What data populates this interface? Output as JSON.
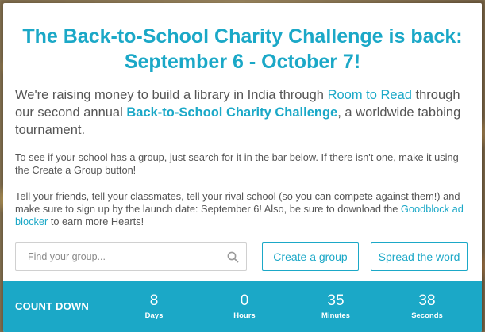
{
  "headline": "The Back-to-School Charity Challenge is back: September 6 - October 7!",
  "lead": {
    "before_link": "We're raising money to build a library in India through ",
    "link_room_to_read": "Room to Read",
    "middle": " through our second annual ",
    "link_challenge": "Back-to-School Charity Challenge",
    "after": ", a worldwide tabbing tournament."
  },
  "para1": "To see if your school has a group, just search for it in the bar below. If there isn't one, make it using the Create a Group button!",
  "para2": {
    "before_link": "Tell your friends, tell your classmates, tell your rival school (so you can compete against them!) and make sure to sign up by the launch date: September 6! Also, be sure to download the ",
    "link_goodblock": "Goodblock ad blocker",
    "after": " to earn more Hearts!"
  },
  "search": {
    "placeholder": "Find your group...",
    "value": "",
    "icon": "search-icon"
  },
  "buttons": {
    "create_group": "Create a group",
    "spread_word": "Spread the word"
  },
  "countdown": {
    "label": "COUNT DOWN",
    "days": {
      "value": "8",
      "caption": "Days"
    },
    "hours": {
      "value": "0",
      "caption": "Hours"
    },
    "minutes": {
      "value": "35",
      "caption": "Minutes"
    },
    "seconds": {
      "value": "38",
      "caption": "Seconds"
    }
  },
  "colors": {
    "accent": "#1ba8c7",
    "body_text": "#555555",
    "background": "#ffffff"
  }
}
